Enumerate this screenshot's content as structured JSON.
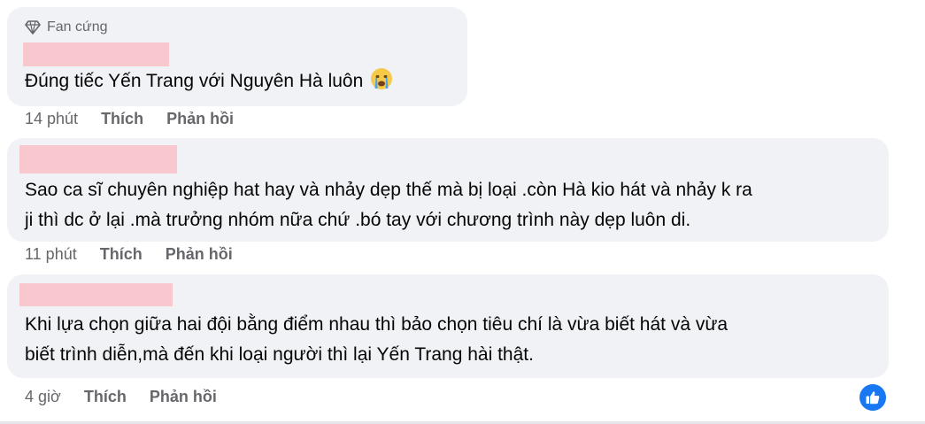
{
  "comments": [
    {
      "badge": "Fan cứng",
      "text_lines": [
        "Đúng tiếc Yến Trang với Nguyên Hà luôn"
      ],
      "emoji": "crying-face-emoji",
      "time": "14 phút",
      "like_label": "Thích",
      "reply_label": "Phản hồi"
    },
    {
      "text_lines": [
        "Sao ca sĩ chuyên nghiệp hat hay và nhảy dẹp thế mà bị loại .còn Hà kio hát và nhảy k ra",
        "ji thì dc ở lại .mà trưởng nhóm nữa chứ .bó tay với chương trình này dẹp luôn di."
      ],
      "time": "11 phút",
      "like_label": "Thích",
      "reply_label": "Phản hồi"
    },
    {
      "text_lines": [
        "Khi lựa chọn giữa hai đội bằng điểm nhau thì bảo chọn tiêu chí là vừa biết hát và vừa",
        "biết trình diễn,mà đến khi loại người thì lại Yến Trang hài thật."
      ],
      "time": "4 giờ",
      "like_label": "Thích",
      "reply_label": "Phản hồi",
      "reaction_icon": "like-reaction-icon"
    }
  ],
  "colors": {
    "bubble": "#f0f2f5",
    "redaction": "#f9c8cf",
    "meta_text": "#65676b",
    "like_blue": "#1877f2"
  }
}
